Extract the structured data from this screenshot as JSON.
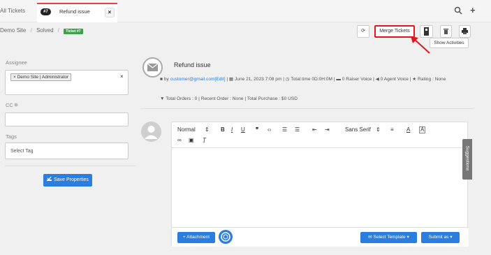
{
  "tabs": {
    "all_tickets": "All Tickets",
    "active_badge": "#7",
    "active_title": "Refund issue",
    "close_glyph": "×"
  },
  "toolbar_right": {
    "search_icon": "search-icon",
    "plus_glyph": "+"
  },
  "breadcrumb": {
    "site": "Demo Site",
    "sep": "/",
    "status": "Solved",
    "ticket_badge": "Ticket #7"
  },
  "actions": {
    "refresh_glyph": "⟳",
    "merge_label": "Merge Tickets",
    "activities_label": "Show Activities",
    "highlight_color": "#e8141b"
  },
  "properties": {
    "assignee_label": "Assignee",
    "assignee_chip": "× Demo Site | Administrator",
    "clear_glyph": "×",
    "cc_label": "CC",
    "tags_label": "Tags",
    "tags_placeholder": "Select Tag",
    "save_label": "Save Properties"
  },
  "thread": {
    "subject": "Refund issue",
    "by_prefix": "by",
    "email": "customer@gmail.com",
    "edit_link": "[Edit]",
    "meta_rest": "| ▦ June 21, 2023 7:08 pm | ◷ Total time 0D:0H:0M | ▬ 0 Raiser Voice | ◀ 0 Agent Voice | ★ Rating : None",
    "orders": "Total Orders : 0 | Recent Order : None | Total Purchase : $0 USD"
  },
  "editor": {
    "format": "Normal",
    "font": "Sans Serif",
    "attachment_label": "Attachment",
    "template_label": "Select Template",
    "submit_label": "Submit as",
    "suggestions_label": "Suggestions"
  }
}
